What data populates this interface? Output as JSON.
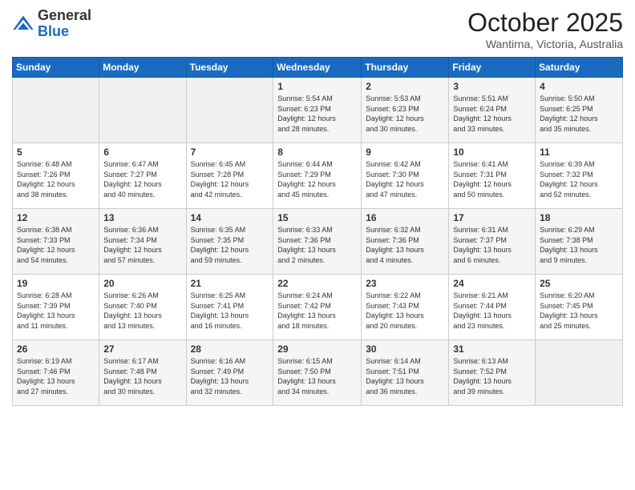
{
  "logo": {
    "general": "General",
    "blue": "Blue"
  },
  "title": "October 2025",
  "location": "Wantirna, Victoria, Australia",
  "days_of_week": [
    "Sunday",
    "Monday",
    "Tuesday",
    "Wednesday",
    "Thursday",
    "Friday",
    "Saturday"
  ],
  "weeks": [
    [
      {
        "day": "",
        "info": ""
      },
      {
        "day": "",
        "info": ""
      },
      {
        "day": "",
        "info": ""
      },
      {
        "day": "1",
        "info": "Sunrise: 5:54 AM\nSunset: 6:23 PM\nDaylight: 12 hours\nand 28 minutes."
      },
      {
        "day": "2",
        "info": "Sunrise: 5:53 AM\nSunset: 6:23 PM\nDaylight: 12 hours\nand 30 minutes."
      },
      {
        "day": "3",
        "info": "Sunrise: 5:51 AM\nSunset: 6:24 PM\nDaylight: 12 hours\nand 33 minutes."
      },
      {
        "day": "4",
        "info": "Sunrise: 5:50 AM\nSunset: 6:25 PM\nDaylight: 12 hours\nand 35 minutes."
      }
    ],
    [
      {
        "day": "5",
        "info": "Sunrise: 6:48 AM\nSunset: 7:26 PM\nDaylight: 12 hours\nand 38 minutes."
      },
      {
        "day": "6",
        "info": "Sunrise: 6:47 AM\nSunset: 7:27 PM\nDaylight: 12 hours\nand 40 minutes."
      },
      {
        "day": "7",
        "info": "Sunrise: 6:45 AM\nSunset: 7:28 PM\nDaylight: 12 hours\nand 42 minutes."
      },
      {
        "day": "8",
        "info": "Sunrise: 6:44 AM\nSunset: 7:29 PM\nDaylight: 12 hours\nand 45 minutes."
      },
      {
        "day": "9",
        "info": "Sunrise: 6:42 AM\nSunset: 7:30 PM\nDaylight: 12 hours\nand 47 minutes."
      },
      {
        "day": "10",
        "info": "Sunrise: 6:41 AM\nSunset: 7:31 PM\nDaylight: 12 hours\nand 50 minutes."
      },
      {
        "day": "11",
        "info": "Sunrise: 6:39 AM\nSunset: 7:32 PM\nDaylight: 12 hours\nand 52 minutes."
      }
    ],
    [
      {
        "day": "12",
        "info": "Sunrise: 6:38 AM\nSunset: 7:33 PM\nDaylight: 12 hours\nand 54 minutes."
      },
      {
        "day": "13",
        "info": "Sunrise: 6:36 AM\nSunset: 7:34 PM\nDaylight: 12 hours\nand 57 minutes."
      },
      {
        "day": "14",
        "info": "Sunrise: 6:35 AM\nSunset: 7:35 PM\nDaylight: 12 hours\nand 59 minutes."
      },
      {
        "day": "15",
        "info": "Sunrise: 6:33 AM\nSunset: 7:36 PM\nDaylight: 13 hours\nand 2 minutes."
      },
      {
        "day": "16",
        "info": "Sunrise: 6:32 AM\nSunset: 7:36 PM\nDaylight: 13 hours\nand 4 minutes."
      },
      {
        "day": "17",
        "info": "Sunrise: 6:31 AM\nSunset: 7:37 PM\nDaylight: 13 hours\nand 6 minutes."
      },
      {
        "day": "18",
        "info": "Sunrise: 6:29 AM\nSunset: 7:38 PM\nDaylight: 13 hours\nand 9 minutes."
      }
    ],
    [
      {
        "day": "19",
        "info": "Sunrise: 6:28 AM\nSunset: 7:39 PM\nDaylight: 13 hours\nand 11 minutes."
      },
      {
        "day": "20",
        "info": "Sunrise: 6:26 AM\nSunset: 7:40 PM\nDaylight: 13 hours\nand 13 minutes."
      },
      {
        "day": "21",
        "info": "Sunrise: 6:25 AM\nSunset: 7:41 PM\nDaylight: 13 hours\nand 16 minutes."
      },
      {
        "day": "22",
        "info": "Sunrise: 6:24 AM\nSunset: 7:42 PM\nDaylight: 13 hours\nand 18 minutes."
      },
      {
        "day": "23",
        "info": "Sunrise: 6:22 AM\nSunset: 7:43 PM\nDaylight: 13 hours\nand 20 minutes."
      },
      {
        "day": "24",
        "info": "Sunrise: 6:21 AM\nSunset: 7:44 PM\nDaylight: 13 hours\nand 23 minutes."
      },
      {
        "day": "25",
        "info": "Sunrise: 6:20 AM\nSunset: 7:45 PM\nDaylight: 13 hours\nand 25 minutes."
      }
    ],
    [
      {
        "day": "26",
        "info": "Sunrise: 6:19 AM\nSunset: 7:46 PM\nDaylight: 13 hours\nand 27 minutes."
      },
      {
        "day": "27",
        "info": "Sunrise: 6:17 AM\nSunset: 7:48 PM\nDaylight: 13 hours\nand 30 minutes."
      },
      {
        "day": "28",
        "info": "Sunrise: 6:16 AM\nSunset: 7:49 PM\nDaylight: 13 hours\nand 32 minutes."
      },
      {
        "day": "29",
        "info": "Sunrise: 6:15 AM\nSunset: 7:50 PM\nDaylight: 13 hours\nand 34 minutes."
      },
      {
        "day": "30",
        "info": "Sunrise: 6:14 AM\nSunset: 7:51 PM\nDaylight: 13 hours\nand 36 minutes."
      },
      {
        "day": "31",
        "info": "Sunrise: 6:13 AM\nSunset: 7:52 PM\nDaylight: 13 hours\nand 39 minutes."
      },
      {
        "day": "",
        "info": ""
      }
    ]
  ]
}
